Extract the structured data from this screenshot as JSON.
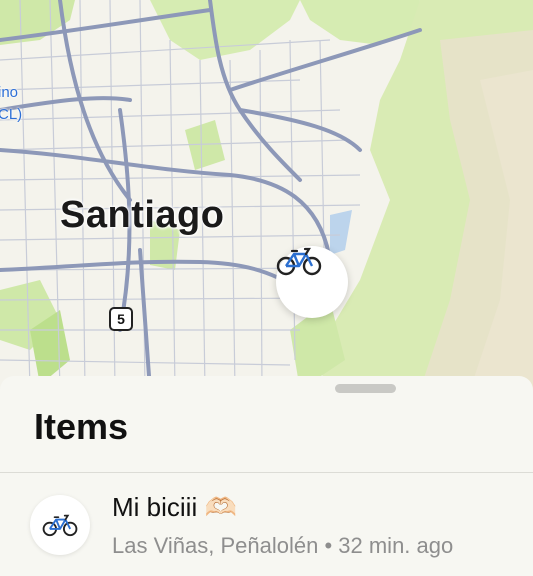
{
  "map": {
    "city_label": "Santiago",
    "side_label_lines": [
      "ino",
      "CL)"
    ],
    "route_shield": "5",
    "pin_icon": "bicycle-icon"
  },
  "sheet": {
    "title": "Items",
    "items": [
      {
        "name": "Mi biciii 🫶🏻",
        "location": "Las Viñas, Peñalolén",
        "separator": "•",
        "time": "32 min. ago",
        "icon": "bicycle-icon"
      }
    ]
  },
  "colors": {
    "map_land": "#f4f3ec",
    "park_green": "#cfe8a8",
    "road": "#9fa9c4",
    "major_road": "#8d98b8",
    "sheet_bg": "#f7f7f2",
    "label_blue": "#2d6fd6"
  }
}
